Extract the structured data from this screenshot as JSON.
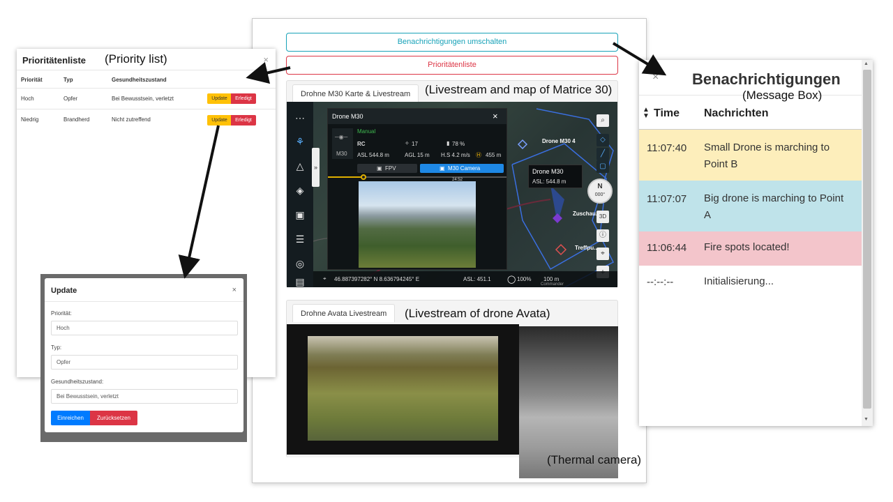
{
  "annotations": {
    "priority_list": "(Priority list)",
    "m30_stream": "(Livestream and map of Matrice 30)",
    "message_box": "(Message Box)",
    "avata_stream": "(Livestream of drone Avata)",
    "thermal": "(Thermal camera)"
  },
  "main": {
    "toggle_notifications": "Benachrichtigungen umschalten",
    "priority_list_button": "Prioritätenliste",
    "m30_tab": "Drohne M30 Karte & Livestream",
    "avata_tab": "Drohne Avata Livestream"
  },
  "m30": {
    "panel_title": "Drone M30",
    "mode": "Manual",
    "drone_label": "M30",
    "rc": "RC",
    "satellites": "17",
    "battery": "78 %",
    "asl": "ASL 544.8 m",
    "agl": "AGL 15 m",
    "hs": "H.S 4.2 m/s",
    "dist": "455 m",
    "fpv": "FPV",
    "camera": "M30 Camera",
    "timeline_value": "24:52",
    "map_drone_1": "Drone M30 4",
    "map_tooltip_title": "Drone M30",
    "map_tooltip_asl": "ASL: 544.8 m",
    "map_label_2": "Zuschau...",
    "map_label_3": "Treffpu...",
    "compass": "N",
    "compass_deg": "000°",
    "btn_3d": "3D",
    "zoom_in": "+",
    "coords": "46.887397282° N  8.636794245° E",
    "asl_status": "ASL: 451.1",
    "percent": "100%",
    "scale": "100 m",
    "commander": "Commander"
  },
  "priority": {
    "title": "Prioritätenliste",
    "close": "×",
    "headers": [
      "Priorität",
      "Typ",
      "Gesundheitszustand"
    ],
    "rows": [
      {
        "priority": "Hoch",
        "type": "Opfer",
        "health": "Bei Bewusstsein, verletzt"
      },
      {
        "priority": "Niedrig",
        "type": "Brandherd",
        "health": "Nicht zutreffend"
      }
    ],
    "update_label": "Update",
    "done_label": "Erledigt"
  },
  "update_modal": {
    "title": "Update",
    "close": "×",
    "priority_label": "Priorität:",
    "priority_value": "Hoch",
    "type_label": "Typ:",
    "type_value": "Opfer",
    "health_label": "Gesundheitszustand:",
    "health_value": "Bei Bewusstsein, verletzt",
    "submit": "Einreichen",
    "reset": "Zurücksetzen"
  },
  "notifications": {
    "title": "Benachrichtigungen",
    "close": "×",
    "col_time": "Time",
    "col_msg": "Nachrichten",
    "rows": [
      {
        "time": "11:07:40",
        "message": "Small Drone is marching to Point B",
        "color": "#fdeebb"
      },
      {
        "time": "11:07:07",
        "message": "Big drone is marching to Point A",
        "color": "#bfe3ea"
      },
      {
        "time": "11:06:44",
        "message": "Fire spots located!",
        "color": "#f3c5cb"
      },
      {
        "time": "--:--:--",
        "message": "Initialisierung...",
        "color": "#ffffff"
      }
    ]
  }
}
